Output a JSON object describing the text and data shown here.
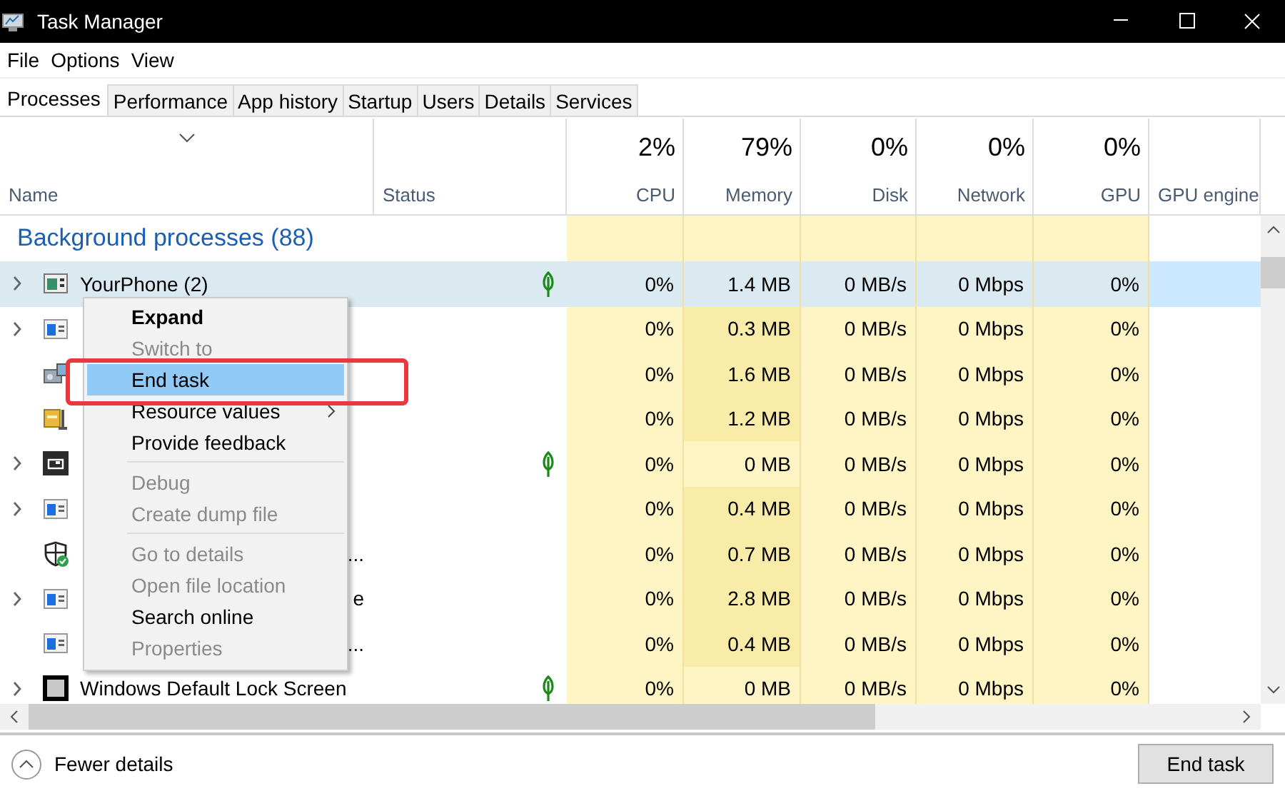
{
  "window": {
    "title": "Task Manager"
  },
  "menu_bar": [
    "File",
    "Options",
    "View"
  ],
  "tabs": [
    {
      "label": "Processes",
      "selected": true
    },
    {
      "label": "Performance",
      "selected": false
    },
    {
      "label": "App history",
      "selected": false
    },
    {
      "label": "Startup",
      "selected": false
    },
    {
      "label": "Users",
      "selected": false
    },
    {
      "label": "Details",
      "selected": false
    },
    {
      "label": "Services",
      "selected": false
    }
  ],
  "columns": [
    {
      "label": "Name"
    },
    {
      "label": "Status"
    },
    {
      "label": "CPU",
      "total": "2%"
    },
    {
      "label": "Memory",
      "total": "79%"
    },
    {
      "label": "Disk",
      "total": "0%"
    },
    {
      "label": "Network",
      "total": "0%"
    },
    {
      "label": "GPU",
      "total": "0%"
    },
    {
      "label": "GPU engine"
    }
  ],
  "group": "Background processes (88)",
  "rows": [
    {
      "name": "YourPhone (2)",
      "name_partial": false,
      "expandable": true,
      "leaf": true,
      "selected": true,
      "memory_highlighted": true,
      "cpu": "0%",
      "memory": "1.4 MB",
      "disk": "0 MB/s",
      "network": "0 Mbps",
      "gpu": "0%"
    },
    {
      "expandable": true,
      "leaf": false,
      "selected": false,
      "memory_highlighted": true,
      "cpu": "0%",
      "memory": "0.3 MB",
      "disk": "0 MB/s",
      "network": "0 Mbps",
      "gpu": "0%"
    },
    {
      "expandable": false,
      "leaf": false,
      "selected": false,
      "memory_highlighted": true,
      "cpu": "0%",
      "memory": "1.6 MB",
      "disk": "0 MB/s",
      "network": "0 Mbps",
      "gpu": "0%"
    },
    {
      "expandable": false,
      "leaf": false,
      "selected": false,
      "memory_highlighted": true,
      "cpu": "0%",
      "memory": "1.2 MB",
      "disk": "0 MB/s",
      "network": "0 Mbps",
      "gpu": "0%"
    },
    {
      "expandable": true,
      "leaf": true,
      "selected": false,
      "memory_highlighted": false,
      "cpu": "0%",
      "memory": "0 MB",
      "disk": "0 MB/s",
      "network": "0 Mbps",
      "gpu": "0%"
    },
    {
      "expandable": true,
      "leaf": false,
      "selected": false,
      "memory_highlighted": true,
      "cpu": "0%",
      "memory": "0.4 MB",
      "disk": "0 MB/s",
      "network": "0 Mbps",
      "gpu": "0%"
    },
    {
      "name": "...",
      "name_partial": true,
      "expandable": false,
      "leaf": false,
      "selected": false,
      "memory_highlighted": true,
      "cpu": "0%",
      "memory": "0.7 MB",
      "disk": "0 MB/s",
      "network": "0 Mbps",
      "gpu": "0%"
    },
    {
      "name": "e",
      "name_partial": true,
      "expandable": true,
      "leaf": false,
      "selected": false,
      "memory_highlighted": true,
      "cpu": "0%",
      "memory": "2.8 MB",
      "disk": "0 MB/s",
      "network": "0 Mbps",
      "gpu": "0%"
    },
    {
      "name": "...",
      "name_partial": true,
      "expandable": false,
      "leaf": false,
      "selected": false,
      "memory_highlighted": true,
      "cpu": "0%",
      "memory": "0.4 MB",
      "disk": "0 MB/s",
      "network": "0 Mbps",
      "gpu": "0%"
    },
    {
      "name": "Windows Default Lock Screen",
      "name_partial": false,
      "expandable": true,
      "leaf": true,
      "selected": false,
      "memory_highlighted": false,
      "cpu": "0%",
      "memory": "0 MB",
      "disk": "0 MB/s",
      "network": "0 Mbps",
      "gpu": "0%"
    }
  ],
  "context_menu": [
    {
      "kind": "item",
      "label": "Expand",
      "default": true,
      "disabled": false,
      "selected": false,
      "submenu": false
    },
    {
      "kind": "item",
      "label": "Switch to",
      "default": false,
      "disabled": true,
      "selected": false,
      "submenu": false
    },
    {
      "kind": "item",
      "label": "End task",
      "default": false,
      "disabled": false,
      "selected": true,
      "submenu": false
    },
    {
      "kind": "item",
      "label": "Resource values",
      "default": false,
      "disabled": false,
      "selected": false,
      "submenu": true
    },
    {
      "kind": "item",
      "label": "Provide feedback",
      "default": false,
      "disabled": false,
      "selected": false,
      "submenu": false
    },
    {
      "kind": "separator"
    },
    {
      "kind": "item",
      "label": "Debug",
      "default": false,
      "disabled": true,
      "selected": false,
      "submenu": false
    },
    {
      "kind": "item",
      "label": "Create dump file",
      "default": false,
      "disabled": true,
      "selected": false,
      "submenu": false
    },
    {
      "kind": "separator"
    },
    {
      "kind": "item",
      "label": "Go to details",
      "default": false,
      "disabled": true,
      "selected": false,
      "submenu": false
    },
    {
      "kind": "item",
      "label": "Open file location",
      "default": false,
      "disabled": true,
      "selected": false,
      "submenu": false
    },
    {
      "kind": "item",
      "label": "Search online",
      "default": false,
      "disabled": false,
      "selected": false,
      "submenu": false
    },
    {
      "kind": "item",
      "label": "Properties",
      "default": false,
      "disabled": true,
      "selected": false,
      "submenu": false
    }
  ],
  "footer": {
    "toggle": "Fewer details",
    "button": "End task"
  }
}
